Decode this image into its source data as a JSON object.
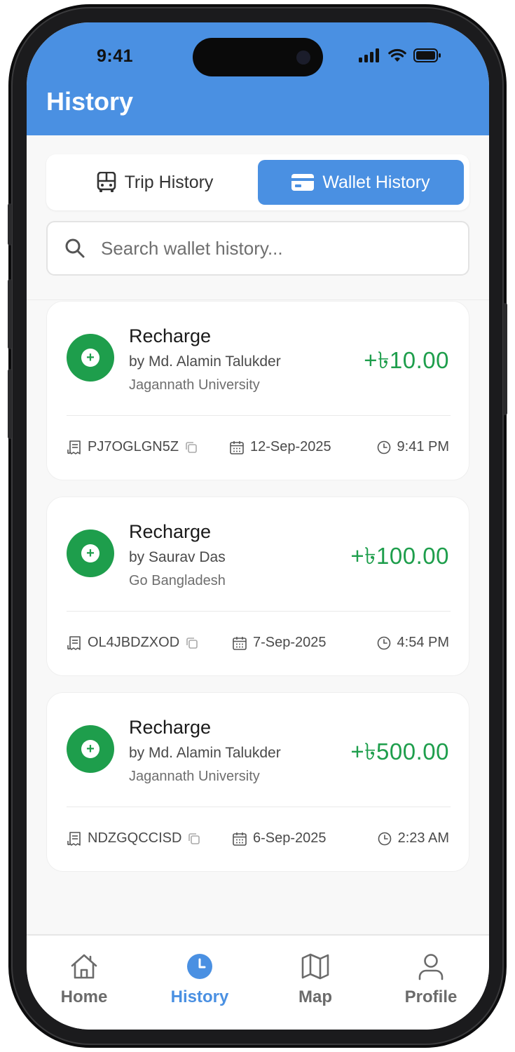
{
  "status_bar": {
    "time": "9:41"
  },
  "header": {
    "title": "History"
  },
  "tabs": [
    {
      "label": "Trip History",
      "icon": "bus-icon",
      "active": false
    },
    {
      "label": "Wallet History",
      "icon": "credit-card-icon",
      "active": true
    }
  ],
  "search": {
    "placeholder": "Search wallet history..."
  },
  "transactions": [
    {
      "title": "Recharge",
      "by": "by Md. Alamin Talukder",
      "org": "Jagannath University",
      "amount": "+৳10.00",
      "id": "PJ7OGLGN5Z",
      "date": "12-Sep-2025",
      "time": "9:41 PM"
    },
    {
      "title": "Recharge",
      "by": "by Saurav Das",
      "org": "Go Bangladesh",
      "amount": "+৳100.00",
      "id": "OL4JBDZXOD",
      "date": "7-Sep-2025",
      "time": "4:54 PM"
    },
    {
      "title": "Recharge",
      "by": "by Md. Alamin Talukder",
      "org": "Jagannath University",
      "amount": "+৳500.00",
      "id": "NDZGQCCISD",
      "date": "6-Sep-2025",
      "time": "2:23 AM"
    }
  ],
  "bottom_nav": [
    {
      "label": "Home",
      "icon": "home-icon",
      "active": false
    },
    {
      "label": "History",
      "icon": "clock-icon",
      "active": true
    },
    {
      "label": "Map",
      "icon": "map-icon",
      "active": false
    },
    {
      "label": "Profile",
      "icon": "user-icon",
      "active": false
    }
  ],
  "colors": {
    "primary": "#4a90e2",
    "positive": "#1e9e4c",
    "background": "#f8f8f8"
  }
}
